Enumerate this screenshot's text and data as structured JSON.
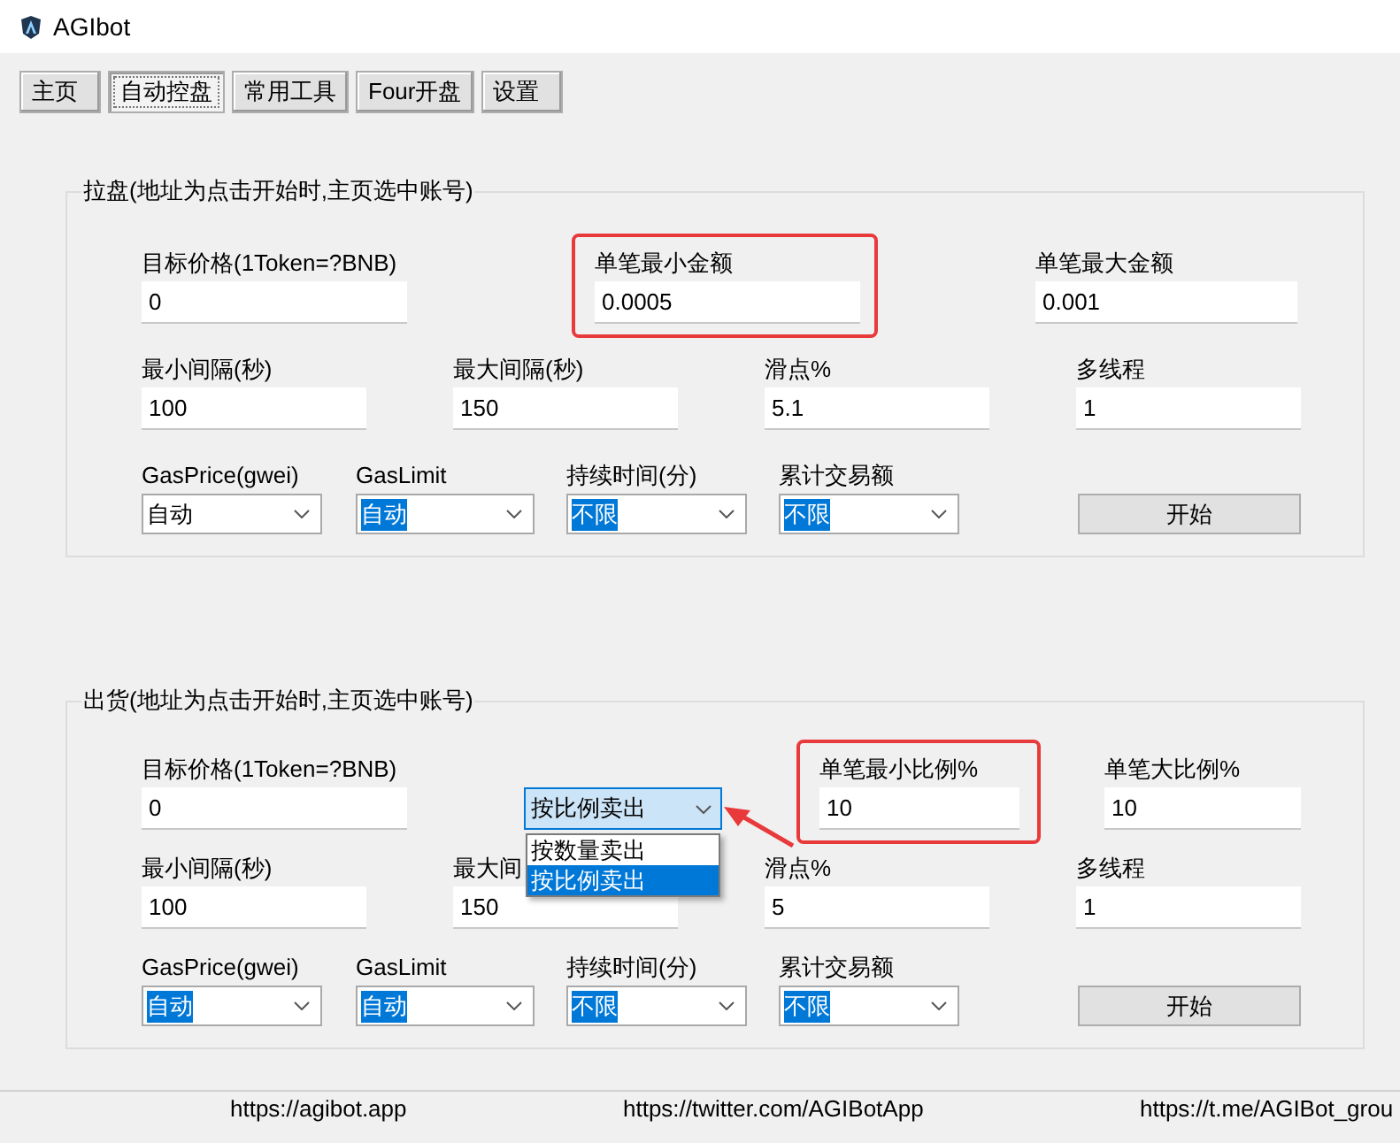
{
  "window": {
    "title": "AGIbot"
  },
  "tabs": [
    {
      "label": "主页",
      "selected": false
    },
    {
      "label": "自动控盘",
      "selected": true
    },
    {
      "label": "常用工具",
      "selected": false
    },
    {
      "label": "Four开盘",
      "selected": false
    },
    {
      "label": "设置",
      "selected": false
    }
  ],
  "groups": [
    {
      "title": "拉盘(地址为点击开始时,主页选中账号)",
      "rows": [
        {
          "fields": [
            {
              "kind": "input",
              "label": "目标价格(1Token=?BNB)",
              "value": "0"
            },
            {
              "kind": "input",
              "label": "单笔最小金额",
              "value": "0.0005",
              "highlighted": true
            },
            {
              "kind": "input",
              "label": "单笔最大金额",
              "value": "0.001"
            }
          ]
        },
        {
          "fields": [
            {
              "kind": "input",
              "label": "最小间隔(秒)",
              "value": "100"
            },
            {
              "kind": "input",
              "label": "最大间隔(秒)",
              "value": "150"
            },
            {
              "kind": "input",
              "label": "滑点%",
              "value": "5.1"
            },
            {
              "kind": "input",
              "label": "多线程",
              "value": "1"
            }
          ]
        },
        {
          "fields": [
            {
              "kind": "select",
              "label": "GasPrice(gwei)",
              "value": "自动",
              "text_selected": false
            },
            {
              "kind": "select",
              "label": "GasLimit",
              "value": "自动",
              "text_selected": true
            },
            {
              "kind": "select",
              "label": "持续时间(分)",
              "value": "不限",
              "text_selected": true
            },
            {
              "kind": "select",
              "label": "累计交易额",
              "value": "不限",
              "text_selected": true
            },
            {
              "kind": "button",
              "label": "开始"
            }
          ]
        }
      ]
    },
    {
      "title": "出货(地址为点击开始时,主页选中账号)",
      "rows": [
        {
          "fields": [
            {
              "kind": "input",
              "label": "目标价格(1Token=?BNB)",
              "value": "0"
            },
            {
              "kind": "dropdown",
              "value": "按比例卖出",
              "expanded": true,
              "pointer_arrow": true,
              "options": [
                {
                  "label": "按数量卖出",
                  "selected": false
                },
                {
                  "label": "按比例卖出",
                  "selected": true
                }
              ]
            },
            {
              "kind": "input",
              "label": "单笔最小比例%",
              "value": "10",
              "highlighted": true
            },
            {
              "kind": "input",
              "label": "单笔大比例%",
              "value": "10"
            }
          ]
        },
        {
          "fields": [
            {
              "kind": "input",
              "label": "最小间隔(秒)",
              "value": "100"
            },
            {
              "kind": "input",
              "label": "最大间",
              "value": "150"
            },
            {
              "kind": "input",
              "label": "滑点%",
              "value": "5"
            },
            {
              "kind": "input",
              "label": "多线程",
              "value": "1"
            }
          ]
        },
        {
          "fields": [
            {
              "kind": "select",
              "label": "GasPrice(gwei)",
              "value": "自动",
              "text_selected": true
            },
            {
              "kind": "select",
              "label": "GasLimit",
              "value": "自动",
              "text_selected": true
            },
            {
              "kind": "select",
              "label": "持续时间(分)",
              "value": "不限",
              "text_selected": true
            },
            {
              "kind": "select",
              "label": "累计交易额",
              "value": "不限",
              "text_selected": true
            },
            {
              "kind": "button",
              "label": "开始"
            }
          ]
        }
      ]
    }
  ],
  "status_bar": {
    "links": [
      "https://agibot.app",
      "https://twitter.com/AGIBotApp",
      "https://t.me/AGIBot_grou"
    ]
  }
}
